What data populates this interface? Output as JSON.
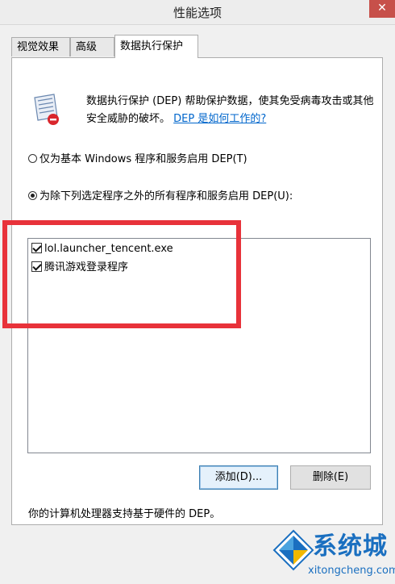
{
  "window": {
    "title": "性能选项",
    "close_glyph": "✕"
  },
  "tabs": [
    {
      "label": "视觉效果",
      "active": false
    },
    {
      "label": "高级",
      "active": false
    },
    {
      "label": "数据执行保护",
      "active": true
    }
  ],
  "dep": {
    "icon": "dep-shield-icon",
    "description": "数据执行保护 (DEP) 帮助保护数据，使其免受病毒攻击或其他安全威胁的破坏。",
    "link_label": "DEP 是如何工作的?"
  },
  "options": {
    "essential_only": {
      "label": "仅为基本 Windows 程序和服务启用 DEP(T)",
      "checked": false
    },
    "all_except": {
      "label": "为除下列选定程序之外的所有程序和服务启用 DEP(U):",
      "checked": true
    }
  },
  "program_list": [
    {
      "label": "lol.launcher_tencent.exe",
      "checked": true
    },
    {
      "label": "腾讯游戏登录程序",
      "checked": true
    }
  ],
  "buttons": {
    "add_label": "添加(D)...",
    "remove_label": "删除(E)"
  },
  "status_text": "你的计算机处理器支持基于硬件的 DEP。",
  "annotation": {
    "color": "#e8323a"
  },
  "watermark": {
    "brand": "系统城",
    "url": "xitongcheng.com"
  },
  "colors": {
    "link": "#0066cc",
    "brand": "#1a6fc0"
  }
}
